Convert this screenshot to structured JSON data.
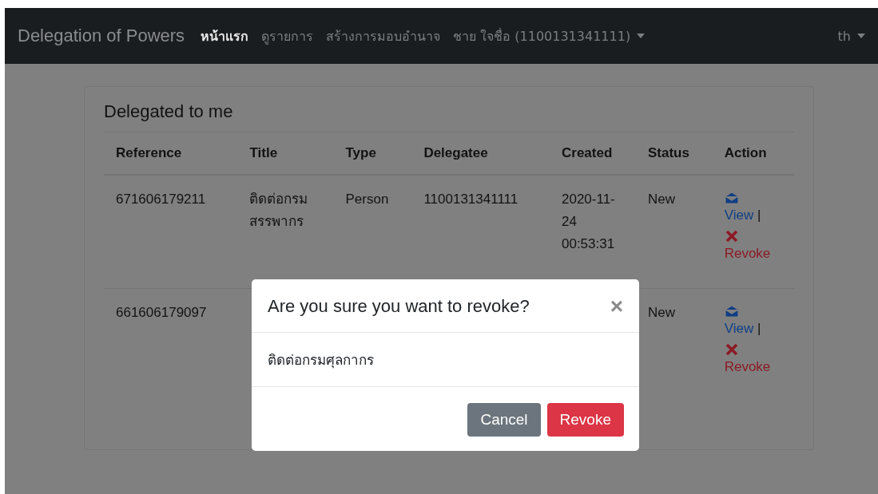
{
  "navbar": {
    "brand": "Delegation of Powers",
    "links": [
      {
        "label": "หน้าแรก",
        "selected": true
      },
      {
        "label": "ดูรายการ",
        "selected": false
      },
      {
        "label": "สร้างการมอบอำนาจ",
        "selected": false
      }
    ],
    "user_menu": "ชาย ใจชื่อ (1100131341111)",
    "language_menu": "th"
  },
  "card": {
    "title": "Delegated to me",
    "table": {
      "columns": [
        "Reference",
        "Title",
        "Type",
        "Delegatee",
        "Created",
        "Status",
        "Action"
      ],
      "rows": [
        {
          "reference": "671606179211",
          "title": "ติดต่อกรม สรรพากร",
          "type": "Person",
          "delegatee": "1100131341111",
          "created": "2020-11- 24 00:53:31",
          "status": "New",
          "view": "View",
          "separator": "|",
          "revoke": "Revoke"
        },
        {
          "reference": "661606179097",
          "status": "New",
          "view": "View",
          "separator": "|",
          "revoke": "Revoke"
        }
      ]
    }
  },
  "modal": {
    "title": "Are you sure you want to revoke?",
    "close": "×",
    "body": "ติดต่อกรมศุลกากร",
    "buttons": [
      {
        "label": "Cancel",
        "kind": "secondary"
      },
      {
        "label": "Revoke",
        "kind": "danger"
      }
    ]
  }
}
